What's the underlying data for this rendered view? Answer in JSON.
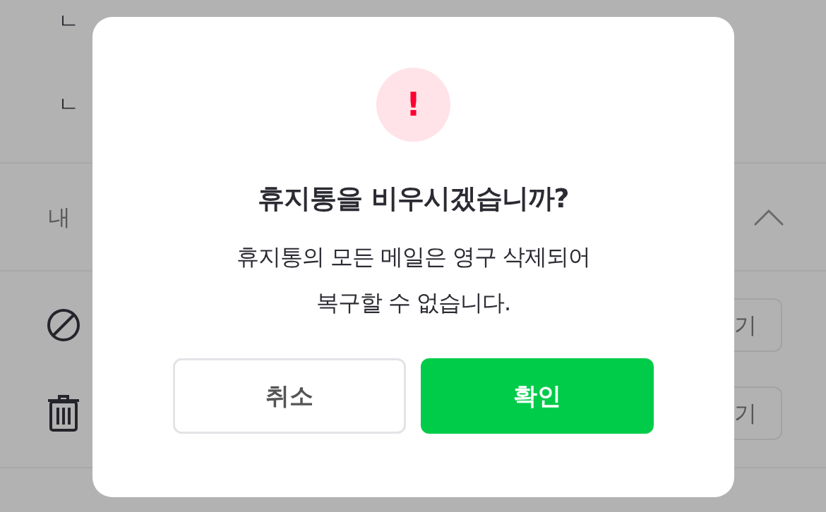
{
  "background": {
    "tree_items": [
      {
        "marker": "ㄴ"
      },
      {
        "marker": "ㄴ"
      }
    ],
    "section": {
      "title": "내",
      "expanded": true
    },
    "rows": [
      {
        "kind": "block",
        "button": "기"
      },
      {
        "kind": "trash",
        "button": "기"
      }
    ]
  },
  "dialog": {
    "title": "휴지통을 비우시겠습니까?",
    "message_lines": [
      "휴지통의 모든 메일은 영구 삭제되어",
      "복구할 수 없습니다."
    ],
    "icon": "!",
    "buttons": [
      {
        "kind": "cancel",
        "label": "취소"
      },
      {
        "kind": "confirm",
        "label": "확인"
      }
    ]
  }
}
